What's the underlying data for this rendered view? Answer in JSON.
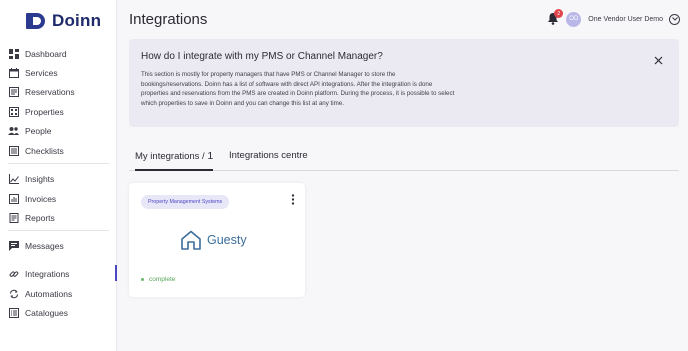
{
  "app": {
    "name": "Doinn"
  },
  "colors": {
    "accent": "#4a47c8",
    "brand": "#1f2a6b",
    "notification": "#e0454b",
    "status_complete": "#5aa85a",
    "guesty": "#3d6e9b"
  },
  "sidebar": {
    "items": [
      {
        "label": "Dashboard",
        "icon": "dashboard-icon"
      },
      {
        "label": "Services",
        "icon": "calendar-icon"
      },
      {
        "label": "Reservations",
        "icon": "reservations-icon"
      },
      {
        "label": "Properties",
        "icon": "building-icon"
      },
      {
        "label": "People",
        "icon": "people-icon"
      },
      {
        "label": "Checklists",
        "icon": "checklist-icon"
      },
      {
        "label": "Insights",
        "icon": "chart-line-icon"
      },
      {
        "label": "Invoices",
        "icon": "invoice-icon"
      },
      {
        "label": "Reports",
        "icon": "report-icon"
      },
      {
        "label": "Messages",
        "icon": "message-icon"
      },
      {
        "label": "Integrations",
        "icon": "link-icon",
        "active": true
      },
      {
        "label": "Automations",
        "icon": "sync-icon"
      },
      {
        "label": "Catalogues",
        "icon": "catalogue-icon"
      }
    ]
  },
  "header": {
    "title": "Integrations",
    "notifications_count": "2",
    "user_initials": "OD",
    "user_name": "One Vendor User Demo"
  },
  "info_box": {
    "title": "How do I integrate with my PMS or Channel Manager?",
    "text": "This section is mostly for property managers that have PMS or Channel Manager to store the bookings/reservations. Doinn has a list of software with direct API integrations. After the integration is done properties and reservations from the PMS are created in Doinn platform. During the process, it is possible to select which properties to save in Doinn and you can change this list at any time."
  },
  "tabs": [
    {
      "label": "My integrations / ",
      "count": "1",
      "active": true
    },
    {
      "label": "Integrations centre",
      "active": false
    }
  ],
  "integration_card": {
    "category": "Property Management Systems",
    "brand": "Guesty",
    "status": "complete"
  }
}
